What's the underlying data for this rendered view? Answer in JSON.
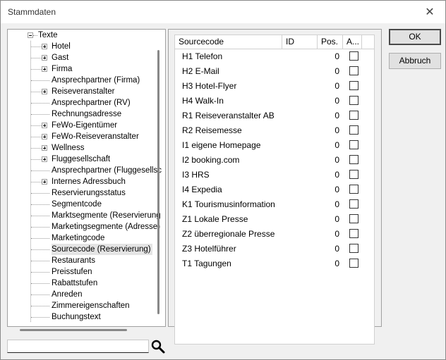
{
  "window": {
    "title": "Stammdaten"
  },
  "tree": {
    "root_label": "Texte",
    "items": [
      {
        "label": "Hotel",
        "expandable": true
      },
      {
        "label": "Gast",
        "expandable": true
      },
      {
        "label": "Firma",
        "expandable": true
      },
      {
        "label": "Ansprechpartner (Firma)",
        "expandable": false
      },
      {
        "label": "Reiseveranstalter",
        "expandable": true
      },
      {
        "label": "Ansprechpartner (RV)",
        "expandable": false
      },
      {
        "label": "Rechnungsadresse",
        "expandable": false
      },
      {
        "label": "FeWo-Eigentümer",
        "expandable": true
      },
      {
        "label": "FeWo-Reiseveranstalter",
        "expandable": true
      },
      {
        "label": "Wellness",
        "expandable": true
      },
      {
        "label": "Fluggesellschaft",
        "expandable": true
      },
      {
        "label": "Ansprechpartner (Fluggesellsc",
        "expandable": false
      },
      {
        "label": "Internes Adressbuch",
        "expandable": true
      },
      {
        "label": "Reservierungsstatus",
        "expandable": false
      },
      {
        "label": "Segmentcode",
        "expandable": false
      },
      {
        "label": "Marktsegmente (Reservierung",
        "expandable": false
      },
      {
        "label": "Marketingsegmente (Adresse)",
        "expandable": false
      },
      {
        "label": "Marketingcode",
        "expandable": false
      },
      {
        "label": "Sourcecode (Reservierung)",
        "expandable": false,
        "selected": true
      },
      {
        "label": "Restaurants",
        "expandable": false
      },
      {
        "label": "Preisstufen",
        "expandable": false
      },
      {
        "label": "Rabattstufen",
        "expandable": false
      },
      {
        "label": "Anreden",
        "expandable": false
      },
      {
        "label": "Zimmereigenschaften",
        "expandable": false
      },
      {
        "label": "Buchungstext",
        "expandable": false
      }
    ]
  },
  "search": {
    "value": "",
    "placeholder": ""
  },
  "grid": {
    "headers": {
      "sourcecode": "Sourcecode",
      "id": "ID",
      "pos": "Pos.",
      "active": "A..."
    },
    "rows": [
      {
        "source": "H1 Telefon",
        "pos": "0",
        "checked": false
      },
      {
        "source": "H2 E-Mail",
        "pos": "0",
        "checked": false
      },
      {
        "source": "H3 Hotel-Flyer",
        "pos": "0",
        "checked": false
      },
      {
        "source": "H4 Walk-In",
        "pos": "0",
        "checked": false
      },
      {
        "source": "R1 Reiseveranstalter AB",
        "pos": "0",
        "checked": false
      },
      {
        "source": "R2 Reisemesse",
        "pos": "0",
        "checked": false
      },
      {
        "source": "I1 eigene Homepage",
        "pos": "0",
        "checked": false
      },
      {
        "source": "I2 booking.com",
        "pos": "0",
        "checked": false
      },
      {
        "source": "I3 HRS",
        "pos": "0",
        "checked": false
      },
      {
        "source": "I4 Expedia",
        "pos": "0",
        "checked": false
      },
      {
        "source": "K1 Tourismusinformation",
        "pos": "0",
        "checked": false
      },
      {
        "source": "Z1 Lokale Presse",
        "pos": "0",
        "checked": false
      },
      {
        "source": "Z2 überregionale Presse",
        "pos": "0",
        "checked": false
      },
      {
        "source": "Z3 Hotelführer",
        "pos": "0",
        "checked": false
      },
      {
        "source": "T1 Tagungen",
        "pos": "0",
        "checked": false
      }
    ]
  },
  "buttons": {
    "ok": "OK",
    "cancel": "Abbruch"
  }
}
